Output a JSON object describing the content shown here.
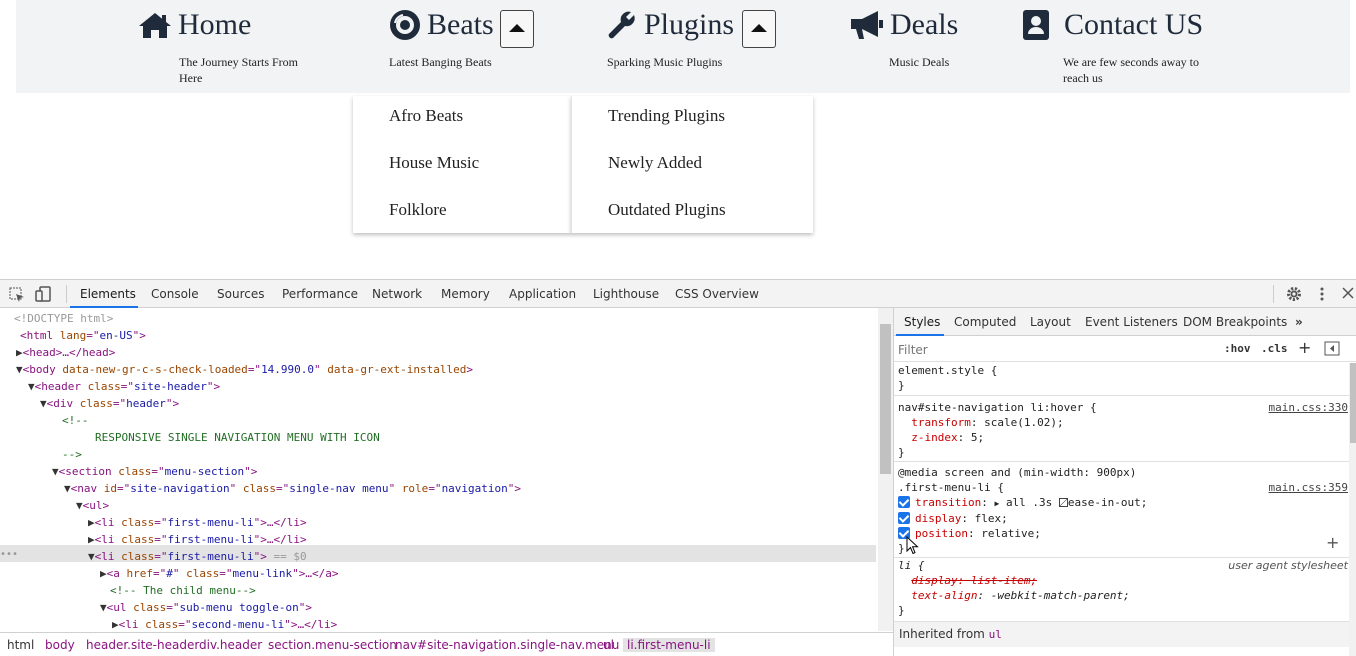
{
  "site_nav": {
    "items": [
      {
        "icon": "home-icon",
        "label": "Home",
        "sub": "The Journey Starts From Here"
      },
      {
        "icon": "disc-icon",
        "label": "Beats",
        "sub": "Latest Banging Beats"
      },
      {
        "icon": "wrench-icon",
        "label": "Plugins",
        "sub": "Sparking Music Plugins"
      },
      {
        "icon": "megaphone-icon",
        "label": "Deals",
        "sub": "Music Deals"
      },
      {
        "icon": "contact-card-icon",
        "label": "Contact US",
        "sub": "We are few seconds away to reach us"
      }
    ],
    "beats_menu": [
      "Afro Beats",
      "House Music",
      "Folklore"
    ],
    "plugins_menu": [
      "Trending Plugins",
      "Newly Added",
      "Outdated Plugins"
    ]
  },
  "devtools": {
    "tabs": [
      "Elements",
      "Console",
      "Sources",
      "Performance",
      "Network",
      "Memory",
      "Application",
      "Lighthouse",
      "CSS Overview"
    ],
    "active_tab": "Elements",
    "dom_lines": {
      "l1": "<!DOCTYPE html>",
      "l2a": "<html ",
      "l2b": "lang",
      "l2c": "=\"",
      "l2d": "en-US",
      "l2e": "\">",
      "l3": "<head>…</head>",
      "l4a": "<body ",
      "l4b": "data-new-gr-c-s-check-loaded",
      "l4c": "=\"",
      "l4d": "14.990.0",
      "l4e": "\" ",
      "l4f": "data-gr-ext-installed",
      "l4g": ">",
      "l5a": "<header ",
      "l5b": "class",
      "l5c": "=\"",
      "l5d": "site-header",
      "l5e": "\">",
      "l6a": "<div ",
      "l6b": "class",
      "l6c": "=\"",
      "l6d": "header",
      "l6e": "\">",
      "l7": "<!--",
      "l8": "RESPONSIVE SINGLE NAVIGATION MENU WITH ICON",
      "l9": "-->",
      "l10a": "<section ",
      "l10b": "class",
      "l10c": "=\"",
      "l10d": "menu-section",
      "l10e": "\">",
      "l11a": "<nav ",
      "l11b": "id",
      "l11c": "=\"",
      "l11d": "site-navigation",
      "l11e": "\" ",
      "l11f": "class",
      "l11g": "=\"",
      "l11h": "single-nav menu",
      "l11i": "\" ",
      "l11j": "role",
      "l11k": "=\"",
      "l11l": "navigation",
      "l11m": "\">",
      "l12": "<ul>",
      "l13a": "<li ",
      "l13b": "class",
      "l13c": "=\"",
      "l13d": "first-menu-li",
      "l13e": "\">…</li>",
      "l15eq": " == $0",
      "l16a": "<a ",
      "l16b": "href",
      "l16c": "=\"",
      "l16d": "#",
      "l16e": "\" ",
      "l16f": "class",
      "l16g": "=\"",
      "l16h": "menu-link",
      "l16i": "\">…</a>",
      "l17": "<!-- The child menu-->",
      "l18a": "<ul ",
      "l18b": "class",
      "l18c": "=\"",
      "l18d": "sub-menu toggle-on",
      "l18e": "\">",
      "l19a": "<li ",
      "l19b": "class",
      "l19c": "=\"",
      "l19d": "second-menu-li",
      "l19e": "\">…</li>",
      "l15b": "\">",
      "ellipsis": "…"
    },
    "breadcrumb": [
      "html",
      "body",
      "header.site-header",
      "div.header",
      "section.menu-section",
      "nav#site-navigation.single-nav.menu",
      "ul",
      "li.first-menu-li"
    ],
    "styles_tabs": [
      "Styles",
      "Computed",
      "Layout",
      "Event Listeners",
      "DOM Breakpoints"
    ],
    "filter_placeholder": "Filter",
    "hov": ":hov",
    "cls": ".cls",
    "rules": {
      "element_style_open": "element.style {",
      "close": "}",
      "hover_sel": "nav#site-navigation li:hover {",
      "hover_src": "main.css:330",
      "transform_prop": "transform",
      "transform_val": ": scale(1.02);",
      "zindex_prop": "z-index",
      "zindex_val": ": 5;",
      "media": "@media screen and (min-width: 900px)",
      "first_sel": ".first-menu-li {",
      "first_src": "main.css:359",
      "transition_prop": "transition",
      "transition_val_a": ": ",
      "transition_val_b": "all .3s ",
      "transition_val_c": "ease-in-out;",
      "display_prop": "display",
      "display_val": ": flex;",
      "position_prop": "position",
      "position_val": ": relative;",
      "li_sel": "li {",
      "ua": "user agent stylesheet",
      "display_struck": "display: list-item;",
      "textalign_prop": "text-align",
      "textalign_val": ": -webkit-match-parent;",
      "inherited_a": "Inherited from ",
      "inherited_b": "ul"
    },
    "more_dots": "•••"
  }
}
